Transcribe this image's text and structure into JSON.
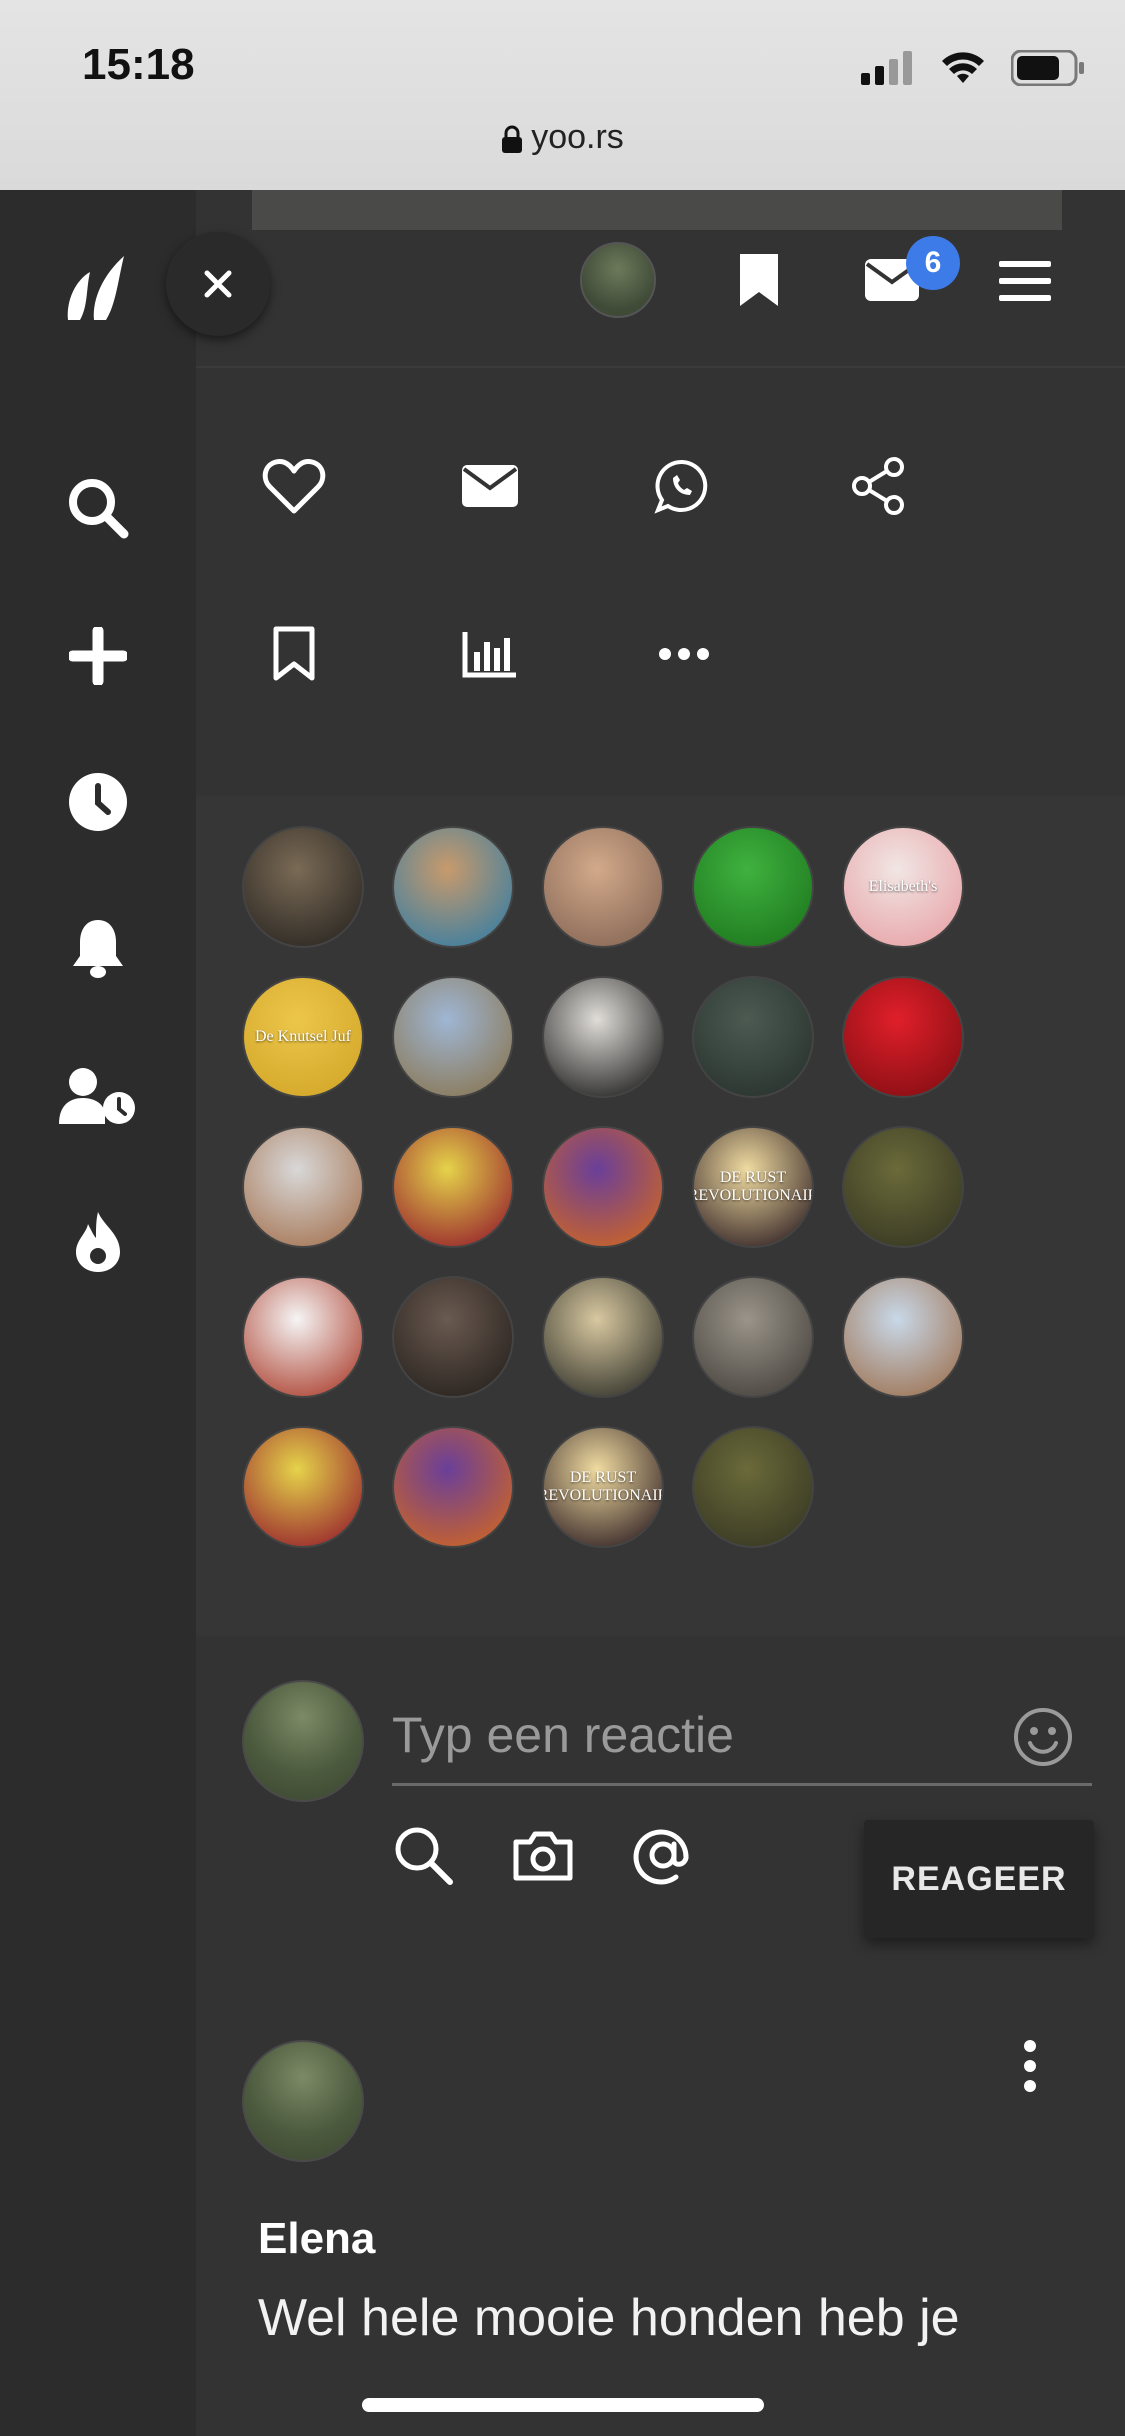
{
  "status_bar": {
    "time": "15:18",
    "url": "yoo.rs"
  },
  "header": {
    "mail_badge_count": "6"
  },
  "sidebar": {
    "items": [
      {
        "name": "search"
      },
      {
        "name": "add"
      },
      {
        "name": "recent"
      },
      {
        "name": "notifications"
      },
      {
        "name": "following"
      },
      {
        "name": "trending"
      }
    ]
  },
  "likers": [
    {
      "colors": [
        "#7a6a55",
        "#2e2a25"
      ]
    },
    {
      "colors": [
        "#c89a6c",
        "#3f7fa0"
      ]
    },
    {
      "colors": [
        "#d2a98a",
        "#8a6a58"
      ]
    },
    {
      "colors": [
        "#3fb23f",
        "#1f7a1f"
      ]
    },
    {
      "colors": [
        "#f1e6e4",
        "#e8a6aa"
      ],
      "text": "Elisabeth's"
    },
    {
      "colors": [
        "#ecc64a",
        "#d4a82a"
      ],
      "text": "De Knutsel Juf"
    },
    {
      "colors": [
        "#9fb6d4",
        "#8a7a5a"
      ]
    },
    {
      "colors": [
        "#e0ddd8",
        "#2a2a2a"
      ]
    },
    {
      "colors": [
        "#4c5a52",
        "#2a3430"
      ]
    },
    {
      "colors": [
        "#e01f2a",
        "#8a0f14"
      ]
    },
    {
      "colors": [
        "#d8d8d8",
        "#a87a5a"
      ]
    },
    {
      "colors": [
        "#e5d34a",
        "#9a2a2e"
      ]
    },
    {
      "colors": [
        "#6a3f9a",
        "#c8632a"
      ]
    },
    {
      "colors": [
        "#f0dba0",
        "#3a2a2a"
      ],
      "text": "DE RUST REVOLUTIONAIR"
    },
    {
      "colors": [
        "#6a6a3a",
        "#3a3a24"
      ]
    },
    {
      "colors": [
        "#f5f5f5",
        "#b04a3a"
      ]
    },
    {
      "colors": [
        "#6a5a50",
        "#2a2420"
      ]
    },
    {
      "colors": [
        "#d8c8a0",
        "#3a3a30"
      ]
    },
    {
      "colors": [
        "#9a948a",
        "#4a4640"
      ]
    },
    {
      "colors": [
        "#c8d8e8",
        "#a0785a"
      ]
    },
    {
      "colors": [
        "#e5d34a",
        "#9a2a2e"
      ]
    },
    {
      "colors": [
        "#6a3f9a",
        "#c8632a"
      ]
    },
    {
      "colors": [
        "#f0dba0",
        "#3a2a2a"
      ],
      "text": "DE RUST REVOLUTIONAIR"
    },
    {
      "colors": [
        "#6a6a3a",
        "#3a3a24"
      ]
    }
  ],
  "comment_box": {
    "placeholder": "Typ een reactie",
    "submit_label": "REAGEER"
  },
  "comment": {
    "author": "Elena",
    "text": "Wel hele mooie honden heb je"
  },
  "colors": {
    "badge": "#3d7be8",
    "background": "#333333",
    "sidebar": "#2c2c2c"
  }
}
